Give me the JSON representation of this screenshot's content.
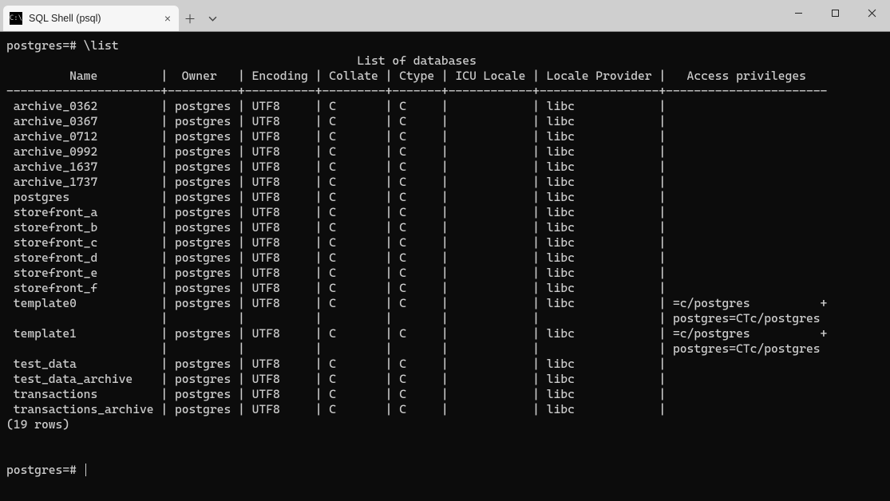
{
  "tab": {
    "title": "SQL Shell (psql)"
  },
  "prompt": "postgres=#",
  "command": "\\list",
  "title": "List of databases",
  "widths": {
    "Name": 22,
    "Owner": 10,
    "Encoding": 10,
    "Collate": 9,
    "Ctype": 7,
    "ICU Locale": 12,
    "Locale Provider": 17,
    "Access privileges": 23
  },
  "columns": [
    "Name",
    "Owner",
    "Encoding",
    "Collate",
    "Ctype",
    "ICU Locale",
    "Locale Provider",
    "Access privileges"
  ],
  "rows": [
    {
      "Name": "archive_0362",
      "Owner": "postgres",
      "Encoding": "UTF8",
      "Collate": "C",
      "Ctype": "C",
      "ICU Locale": "",
      "Locale Provider": "libc",
      "Access privileges": ""
    },
    {
      "Name": "archive_0367",
      "Owner": "postgres",
      "Encoding": "UTF8",
      "Collate": "C",
      "Ctype": "C",
      "ICU Locale": "",
      "Locale Provider": "libc",
      "Access privileges": ""
    },
    {
      "Name": "archive_0712",
      "Owner": "postgres",
      "Encoding": "UTF8",
      "Collate": "C",
      "Ctype": "C",
      "ICU Locale": "",
      "Locale Provider": "libc",
      "Access privileges": ""
    },
    {
      "Name": "archive_0992",
      "Owner": "postgres",
      "Encoding": "UTF8",
      "Collate": "C",
      "Ctype": "C",
      "ICU Locale": "",
      "Locale Provider": "libc",
      "Access privileges": ""
    },
    {
      "Name": "archive_1637",
      "Owner": "postgres",
      "Encoding": "UTF8",
      "Collate": "C",
      "Ctype": "C",
      "ICU Locale": "",
      "Locale Provider": "libc",
      "Access privileges": ""
    },
    {
      "Name": "archive_1737",
      "Owner": "postgres",
      "Encoding": "UTF8",
      "Collate": "C",
      "Ctype": "C",
      "ICU Locale": "",
      "Locale Provider": "libc",
      "Access privileges": ""
    },
    {
      "Name": "postgres",
      "Owner": "postgres",
      "Encoding": "UTF8",
      "Collate": "C",
      "Ctype": "C",
      "ICU Locale": "",
      "Locale Provider": "libc",
      "Access privileges": ""
    },
    {
      "Name": "storefront_a",
      "Owner": "postgres",
      "Encoding": "UTF8",
      "Collate": "C",
      "Ctype": "C",
      "ICU Locale": "",
      "Locale Provider": "libc",
      "Access privileges": ""
    },
    {
      "Name": "storefront_b",
      "Owner": "postgres",
      "Encoding": "UTF8",
      "Collate": "C",
      "Ctype": "C",
      "ICU Locale": "",
      "Locale Provider": "libc",
      "Access privileges": ""
    },
    {
      "Name": "storefront_c",
      "Owner": "postgres",
      "Encoding": "UTF8",
      "Collate": "C",
      "Ctype": "C",
      "ICU Locale": "",
      "Locale Provider": "libc",
      "Access privileges": ""
    },
    {
      "Name": "storefront_d",
      "Owner": "postgres",
      "Encoding": "UTF8",
      "Collate": "C",
      "Ctype": "C",
      "ICU Locale": "",
      "Locale Provider": "libc",
      "Access privileges": ""
    },
    {
      "Name": "storefront_e",
      "Owner": "postgres",
      "Encoding": "UTF8",
      "Collate": "C",
      "Ctype": "C",
      "ICU Locale": "",
      "Locale Provider": "libc",
      "Access privileges": ""
    },
    {
      "Name": "storefront_f",
      "Owner": "postgres",
      "Encoding": "UTF8",
      "Collate": "C",
      "Ctype": "C",
      "ICU Locale": "",
      "Locale Provider": "libc",
      "Access privileges": ""
    },
    {
      "Name": "template0",
      "Owner": "postgres",
      "Encoding": "UTF8",
      "Collate": "C",
      "Ctype": "C",
      "ICU Locale": "",
      "Locale Provider": "libc",
      "Access privileges": "=c/postgres",
      "_cont": true,
      "_ap2": "postgres=CTc/postgres"
    },
    {
      "Name": "template1",
      "Owner": "postgres",
      "Encoding": "UTF8",
      "Collate": "C",
      "Ctype": "C",
      "ICU Locale": "",
      "Locale Provider": "libc",
      "Access privileges": "=c/postgres",
      "_cont": true,
      "_ap2": "postgres=CTc/postgres"
    },
    {
      "Name": "test_data",
      "Owner": "postgres",
      "Encoding": "UTF8",
      "Collate": "C",
      "Ctype": "C",
      "ICU Locale": "",
      "Locale Provider": "libc",
      "Access privileges": ""
    },
    {
      "Name": "test_data_archive",
      "Owner": "postgres",
      "Encoding": "UTF8",
      "Collate": "C",
      "Ctype": "C",
      "ICU Locale": "",
      "Locale Provider": "libc",
      "Access privileges": ""
    },
    {
      "Name": "transactions",
      "Owner": "postgres",
      "Encoding": "UTF8",
      "Collate": "C",
      "Ctype": "C",
      "ICU Locale": "",
      "Locale Provider": "libc",
      "Access privileges": ""
    },
    {
      "Name": "transactions_archive",
      "Owner": "postgres",
      "Encoding": "UTF8",
      "Collate": "C",
      "Ctype": "C",
      "ICU Locale": "",
      "Locale Provider": "libc",
      "Access privileges": ""
    }
  ],
  "footer": "(19 rows)"
}
